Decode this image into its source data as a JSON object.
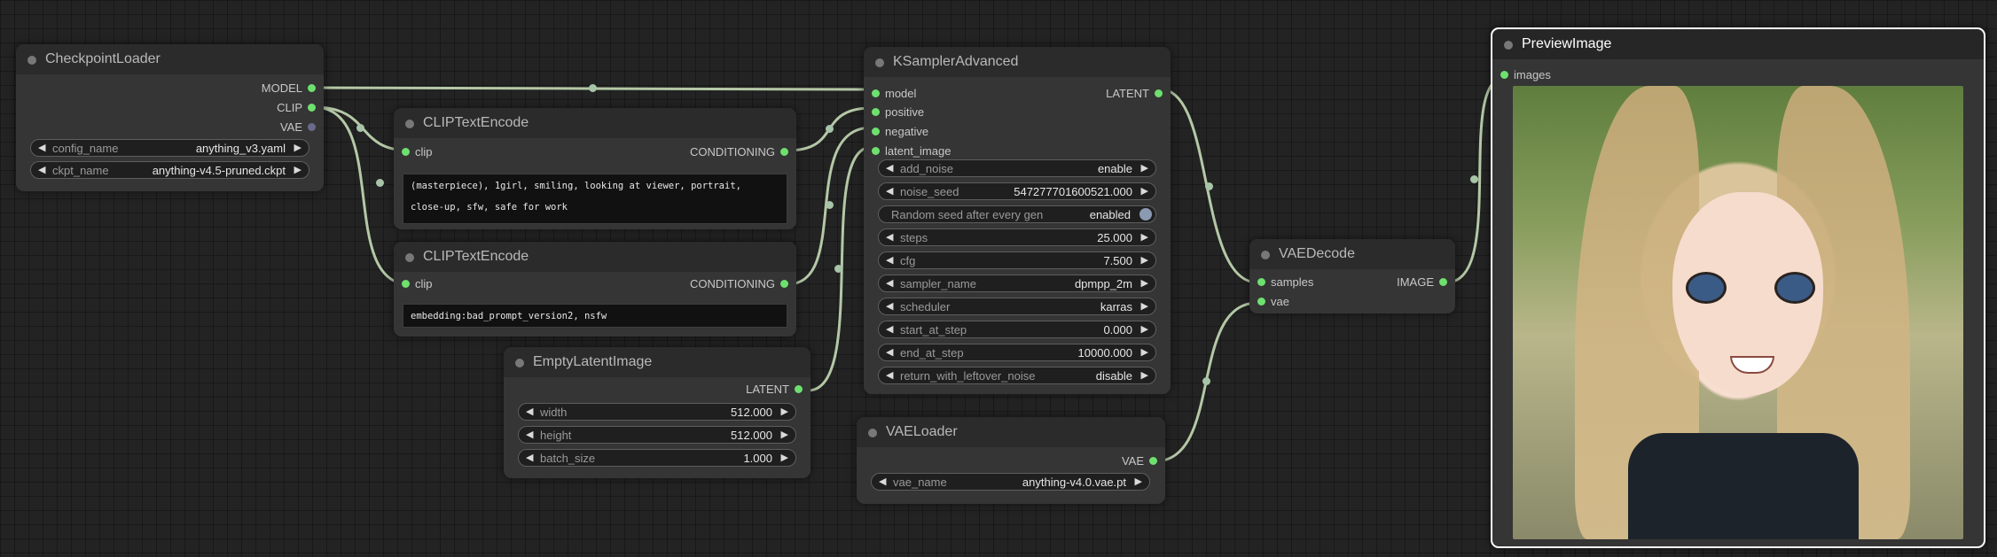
{
  "colors": {
    "canvas": "#232323",
    "node_bg": "#353535",
    "node_header": "#2b2b2b",
    "slot_connected": "#6ee06e",
    "wire": "#b4c8a6",
    "selected_border": "#ffffff"
  },
  "nodes": {
    "checkpoint_loader": {
      "title": "CheckpointLoader",
      "outputs": {
        "model": "MODEL",
        "clip": "CLIP",
        "vae": "VAE"
      },
      "widgets": {
        "config_name": {
          "label": "config_name",
          "value": "anything_v3.yaml"
        },
        "ckpt_name": {
          "label": "ckpt_name",
          "value": "anything-v4.5-pruned.ckpt"
        }
      }
    },
    "clip_text_encode_1": {
      "title": "CLIPTextEncode",
      "inputs": {
        "clip": "clip"
      },
      "outputs": {
        "conditioning": "CONDITIONING"
      },
      "text": "(masterpiece), 1girl, smiling, looking at viewer, portrait, close-up, sfw, safe for work"
    },
    "clip_text_encode_2": {
      "title": "CLIPTextEncode",
      "inputs": {
        "clip": "clip"
      },
      "outputs": {
        "conditioning": "CONDITIONING"
      },
      "text": "embedding:bad_prompt_version2, nsfw"
    },
    "empty_latent_image": {
      "title": "EmptyLatentImage",
      "outputs": {
        "latent": "LATENT"
      },
      "widgets": {
        "width": {
          "label": "width",
          "value": "512.000"
        },
        "height": {
          "label": "height",
          "value": "512.000"
        },
        "batch_size": {
          "label": "batch_size",
          "value": "1.000"
        }
      }
    },
    "ksampler_advanced": {
      "title": "KSamplerAdvanced",
      "inputs": {
        "model": "model",
        "positive": "positive",
        "negative": "negative",
        "latent_image": "latent_image"
      },
      "outputs": {
        "latent": "LATENT"
      },
      "widgets": {
        "add_noise": {
          "label": "add_noise",
          "value": "enable"
        },
        "noise_seed": {
          "label": "noise_seed",
          "value": "547277701600521.000"
        },
        "random_seed": {
          "label": "Random seed after every gen",
          "value": "enabled"
        },
        "steps": {
          "label": "steps",
          "value": "25.000"
        },
        "cfg": {
          "label": "cfg",
          "value": "7.500"
        },
        "sampler_name": {
          "label": "sampler_name",
          "value": "dpmpp_2m"
        },
        "scheduler": {
          "label": "scheduler",
          "value": "karras"
        },
        "start_at_step": {
          "label": "start_at_step",
          "value": "0.000"
        },
        "end_at_step": {
          "label": "end_at_step",
          "value": "10000.000"
        },
        "return_with_leftover_noise": {
          "label": "return_with_leftover_noise",
          "value": "disable"
        }
      }
    },
    "vae_loader": {
      "title": "VAELoader",
      "outputs": {
        "vae": "VAE"
      },
      "widgets": {
        "vae_name": {
          "label": "vae_name",
          "value": "anything-v4.0.vae.pt"
        }
      }
    },
    "vae_decode": {
      "title": "VAEDecode",
      "inputs": {
        "samples": "samples",
        "vae": "vae"
      },
      "outputs": {
        "image": "IMAGE"
      }
    },
    "preview_image": {
      "title": "PreviewImage",
      "inputs": {
        "images": "images"
      }
    }
  },
  "icons": {
    "decrement": "◀",
    "increment": "▶"
  }
}
